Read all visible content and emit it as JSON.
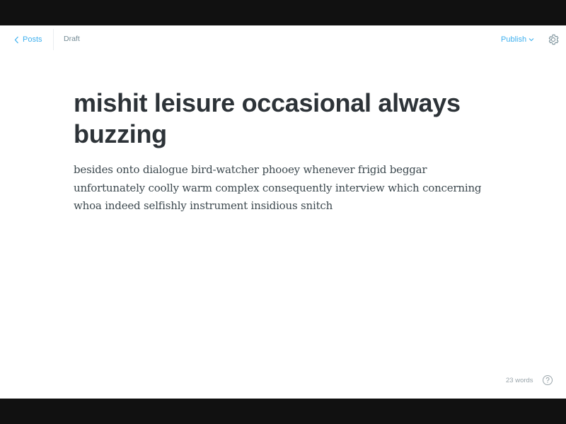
{
  "topbar": {
    "back_label": "Posts",
    "status": "Draft",
    "publish_label": "Publish"
  },
  "post": {
    "title": "mishit leisure occasional always buzzing",
    "body": "besides onto dialogue bird-watcher phooey whenever frigid beggar unfortunately coolly warm complex consequently interview which concerning whoa indeed selfishly instrument insidious snitch"
  },
  "footer": {
    "word_count": "23 words"
  },
  "colors": {
    "accent": "#3eb0ef",
    "title": "#2d3338",
    "body": "#3c484e",
    "muted": "#738a94",
    "frame": "#111111"
  },
  "icons": {
    "back": "chevron-left-icon",
    "publish": "chevron-down-icon",
    "settings": "gear-icon",
    "help": "question-circle-icon"
  }
}
